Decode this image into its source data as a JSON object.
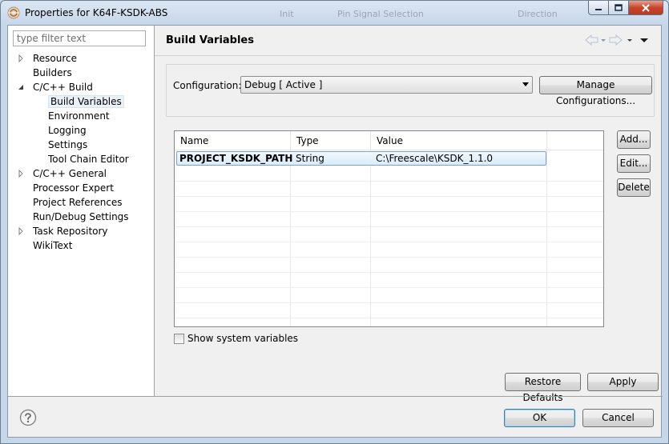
{
  "window": {
    "title": "Properties for K64F-KSDK-ABS",
    "background_tabs": [
      "Init",
      "Pin Signal Selection",
      "Direction"
    ]
  },
  "filter": {
    "placeholder": "type filter text"
  },
  "tree": [
    {
      "label": "Resource",
      "level": 0,
      "expander": "collapsed"
    },
    {
      "label": "Builders",
      "level": 0,
      "expander": "none"
    },
    {
      "label": "C/C++ Build",
      "level": 0,
      "expander": "expanded"
    },
    {
      "label": "Build Variables",
      "level": 1,
      "expander": "none",
      "selected": true
    },
    {
      "label": "Environment",
      "level": 1,
      "expander": "none"
    },
    {
      "label": "Logging",
      "level": 1,
      "expander": "none"
    },
    {
      "label": "Settings",
      "level": 1,
      "expander": "none"
    },
    {
      "label": "Tool Chain Editor",
      "level": 1,
      "expander": "none"
    },
    {
      "label": "C/C++ General",
      "level": 0,
      "expander": "collapsed"
    },
    {
      "label": "Processor Expert",
      "level": 0,
      "expander": "none"
    },
    {
      "label": "Project References",
      "level": 0,
      "expander": "none"
    },
    {
      "label": "Run/Debug Settings",
      "level": 0,
      "expander": "none"
    },
    {
      "label": "Task Repository",
      "level": 0,
      "expander": "collapsed"
    },
    {
      "label": "WikiText",
      "level": 0,
      "expander": "none"
    }
  ],
  "page": {
    "title": "Build Variables",
    "configuration_label": "Configuration:",
    "configuration_value": "Debug  [ Active ]",
    "manage_button": "Manage Configurations..."
  },
  "table": {
    "columns": [
      "Name",
      "Type",
      "Value"
    ],
    "rows": [
      {
        "name": "PROJECT_KSDK_PATH",
        "type": "String",
        "value": "C:\\Freescale\\KSDK_1.1.0"
      }
    ]
  },
  "side_buttons": {
    "add": "Add...",
    "edit": "Edit...",
    "delete": "Delete"
  },
  "show_system_variables": {
    "label": "Show system variables",
    "checked": false
  },
  "footer": {
    "restore_defaults": "Restore Defaults",
    "apply": "Apply",
    "ok": "OK",
    "cancel": "Cancel"
  },
  "colors": {
    "selection": "#d9ebfa",
    "close_button": "#c7452b",
    "title_bar": "#c7d7ea"
  }
}
